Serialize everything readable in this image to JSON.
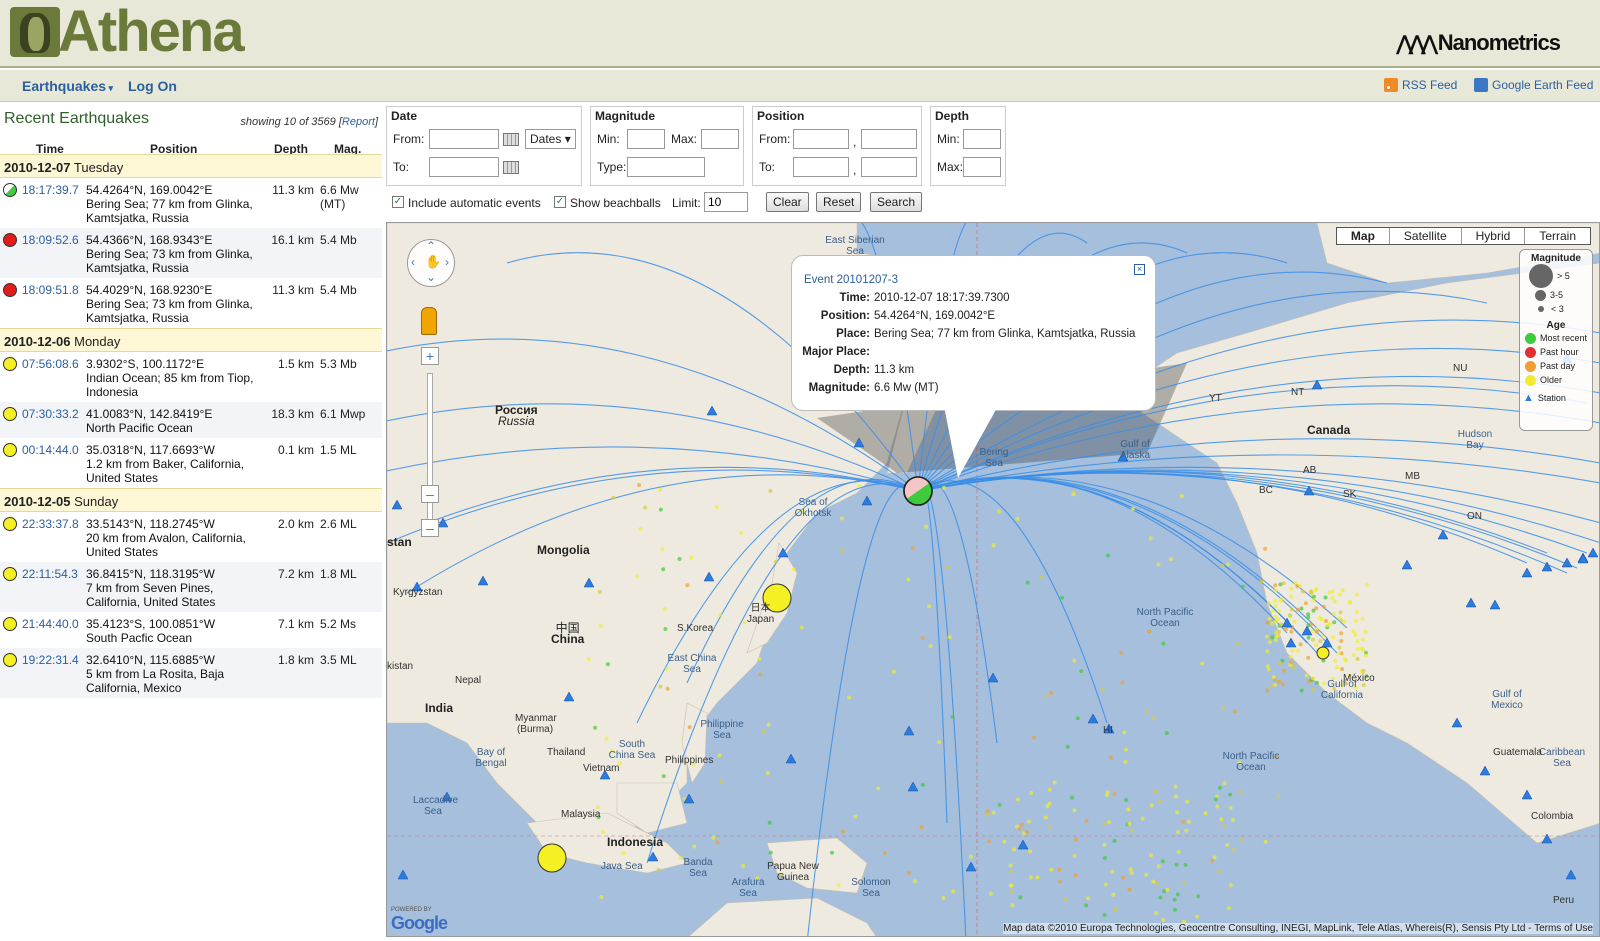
{
  "header": {
    "app_title": "Athena",
    "brand": "Nanometrics",
    "nav": {
      "earthquakes": "Earthquakes",
      "log_on": "Log On"
    },
    "feeds": {
      "rss": "RSS Feed",
      "google_earth": "Google Earth Feed"
    }
  },
  "list": {
    "title": "Recent Earthquakes",
    "showing": "showing 10 of 3569 [",
    "report": "Report",
    "showing_end": "]",
    "columns": [
      "Time",
      "Position",
      "Depth",
      "Mag."
    ],
    "days": [
      {
        "date": "2010-12-07",
        "weekday": "Tuesday"
      },
      {
        "date": "2010-12-06",
        "weekday": "Monday"
      },
      {
        "date": "2010-12-05",
        "weekday": "Sunday"
      }
    ],
    "events": [
      {
        "time": "18:17:39.7",
        "coords": "54.4264°N, 169.0042°E",
        "place": "Bering Sea; 77 km from Glinka, Kamtsjatka, Russia",
        "depth": "11.3 km",
        "mag": "6.6 Mw (MT)",
        "color": "#ffffff"
      },
      {
        "time": "18:09:52.6",
        "coords": "54.4366°N, 168.9343°E",
        "place": "Bering Sea; 73 km from Glinka, Kamtsjatka, Russia",
        "depth": "16.1 km",
        "mag": "5.4 Mb",
        "color": "#e21b1b"
      },
      {
        "time": "18:09:51.8",
        "coords": "54.4029°N, 168.9230°E",
        "place": "Bering Sea; 73 km from Glinka, Kamtsjatka, Russia",
        "depth": "11.3 km",
        "mag": "5.4 Mb",
        "color": "#e21b1b"
      },
      {
        "time": "07:56:08.6",
        "coords": "3.9302°S, 100.1172°E",
        "place": "Indian Ocean; 85 km from Tiop, Indonesia",
        "depth": "1.5 km",
        "mag": "5.3 Mb",
        "color": "#f5f024"
      },
      {
        "time": "07:30:33.2",
        "coords": "41.0083°N, 142.8419°E",
        "place": "North Pacific Ocean",
        "depth": "18.3 km",
        "mag": "6.1 Mwp",
        "color": "#f5f024"
      },
      {
        "time": "00:14:44.0",
        "coords": "35.0318°N, 117.6693°W",
        "place": "1.2 km from Baker, California, United States",
        "depth": "0.1 km",
        "mag": "1.5 ML",
        "color": "#f5f024"
      },
      {
        "time": "22:33:37.8",
        "coords": "33.5143°N, 118.2745°W",
        "place": "20 km from Avalon, California, United States",
        "depth": "2.0 km",
        "mag": "2.6 ML",
        "color": "#f5f024"
      },
      {
        "time": "22:11:54.3",
        "coords": "36.8415°N, 118.3195°W",
        "place": "7 km from Seven Pines, California, United States",
        "depth": "7.2 km",
        "mag": "1.8 ML",
        "color": "#f5f024"
      },
      {
        "time": "21:44:40.0",
        "coords": "35.4123°S, 100.0851°W",
        "place": "South Pacfic Ocean",
        "depth": "7.1 km",
        "mag": "5.2 Ms",
        "color": "#f5f024"
      },
      {
        "time": "19:22:31.4",
        "coords": "32.6410°N, 115.6885°W",
        "place": "5 km from La Rosita, Baja California, Mexico",
        "depth": "1.8 km",
        "mag": "3.5 ML",
        "color": "#f5f024"
      }
    ]
  },
  "search": {
    "date": {
      "label": "Date",
      "from": "From:",
      "to": "To:",
      "mode": "Dates"
    },
    "magnitude": {
      "label": "Magnitude",
      "min": "Min:",
      "max": "Max:",
      "type": "Type:"
    },
    "position": {
      "label": "Position",
      "from": "From:",
      "to": "To:",
      "sep": ","
    },
    "depth": {
      "label": "Depth",
      "min": "Min:",
      "max": "Max:"
    },
    "include_auto": "Include automatic events",
    "show_beachballs": "Show beachballs",
    "limit_label": "Limit:",
    "limit_value": "10",
    "buttons": {
      "clear": "Clear",
      "reset": "Reset",
      "search": "Search"
    }
  },
  "map": {
    "tabs": [
      "Map",
      "Satellite",
      "Hybrid",
      "Terrain"
    ],
    "legend": {
      "magnitude": "Magnitude",
      "sizes": [
        "> 5",
        "3-5",
        "< 3"
      ],
      "age": "Age",
      "ages": [
        {
          "label": "Most recent",
          "color": "#3ecb3e"
        },
        {
          "label": "Past hour",
          "color": "#e23030"
        },
        {
          "label": "Past day",
          "color": "#f0a030"
        },
        {
          "label": "Older",
          "color": "#f0ec30"
        }
      ],
      "station": "Station"
    },
    "popup": {
      "event_label": "Event",
      "event_id": "20101207-3",
      "rows": [
        {
          "k": "Time:",
          "v": "2010-12-07 18:17:39.7300"
        },
        {
          "k": "Position:",
          "v": "54.4264°N, 169.0042°E"
        },
        {
          "k": "Place:",
          "v": "Bering Sea; 77 km from Glinka, Kamtsjatka, Russia"
        },
        {
          "k": "Major Place:",
          "v": ""
        },
        {
          "k": "Depth:",
          "v": "11.3 km"
        },
        {
          "k": "Magnitude:",
          "v": "6.6 Mw (MT)"
        }
      ]
    },
    "labels": {
      "russia": "Россия",
      "russia_en": "Russia",
      "canada": "Canada",
      "china": "China",
      "china_cn": "中国",
      "mongolia": "Mongolia",
      "india": "India",
      "indonesia": "Indonesia",
      "japan": "Japan",
      "japan_jp": "日本",
      "mexico": "México",
      "npo1": "North Pacific Ocean",
      "npo2": "North Pacific Ocean",
      "png": "Papua New Guinea",
      "east_siberian": "East Siberian Sea",
      "bering": "Bering Sea",
      "okhotsk": "Sea of Okhotsk",
      "alaska": "Gulf of Alaska",
      "hudson": "Hudson Bay",
      "philippines": "Philippines",
      "philippine_sea": "Philippine Sea",
      "south_china": "South China Sea",
      "east_china": "East China Sea",
      "bengal": "Bay of Bengal",
      "malaysia": "Malaysia",
      "vietnam": "Vietnam",
      "thailand": "Thailand",
      "myanmar": "Myanmar (Burma)",
      "nepal": "Nepal",
      "kyrgyzstan": "Kyrgyzstan",
      "stan": "stan",
      "kistan": "kistan",
      "s_korea": "S.Korea",
      "java": "Java Sea",
      "banda": "Banda Sea",
      "arafura": "Arafura Sea",
      "solomon": "Solomon Sea",
      "laccadive": "Laccadive Sea",
      "gulf_california": "Gulf of California",
      "gulf_mexico": "Gulf of Mexico",
      "caribbean": "Caribbean Sea",
      "guatemala": "Guatemala",
      "colombia": "Colombia",
      "peru": "Peru",
      "nu": "NU",
      "nt": "NT",
      "yt": "YT",
      "bc": "BC",
      "ab": "AB",
      "sk": "SK",
      "mb": "MB",
      "on": "ON",
      "hi": "HI"
    },
    "footer": "Map data ©2010 Europa Technologies, Geocentre Consulting, INEGI, MapLink, Tele Atlas, Whereis(R), Sensis Pty Ltd - Terms of Use",
    "google": "Google",
    "powered": "POWERED BY"
  },
  "colors": {
    "ocean": "#a5bfdd",
    "land": "#efeae0",
    "ray": "#3a8ee8",
    "station": "#2b7be0"
  }
}
